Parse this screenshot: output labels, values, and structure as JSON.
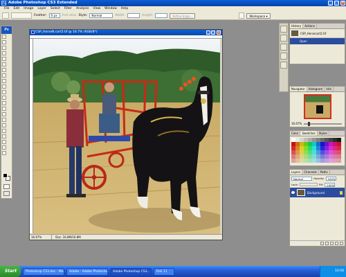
{
  "app": {
    "title": "Adobe Photoshop CS3 Extended"
  },
  "menu": [
    "File",
    "Edit",
    "Image",
    "Layer",
    "Select",
    "Filter",
    "Analysis",
    "View",
    "Window",
    "Help"
  ],
  "options": {
    "feather_label": "Feather:",
    "feather_value": "0 px",
    "antialias_label": "Anti-alias",
    "style_label": "Style:",
    "style_value": "Normal",
    "width_label": "Width:",
    "height_label": "Height:",
    "refine_edge": "Refine Edge...",
    "workspace": "Workspace ▾"
  },
  "tools": {
    "badge": "Ps"
  },
  "document": {
    "title": "CSP_HorseN.cart2.tif @ 16.7% (RGB/8*)",
    "zoom": "16.67%",
    "doc_info": "Doc: 16.8M/16.8M"
  },
  "panels": {
    "history": {
      "tabs": [
        "History",
        "Actions"
      ],
      "snapshot": "CSP_Horsecart2.tif",
      "open": "Open"
    },
    "navigator": {
      "tabs": [
        "Navigator",
        "Histogram",
        "Info"
      ],
      "zoom": "16.67%"
    },
    "swatches": {
      "tabs": [
        "Color",
        "Swatches",
        "Styles"
      ]
    },
    "layers": {
      "tabs": [
        "Layers",
        "Channels",
        "Paths"
      ],
      "blend": "Normal",
      "opacity_label": "Opacity:",
      "opacity": "100%",
      "lock_label": "Lock:",
      "fill_label": "Fill:",
      "fill": "100%",
      "layer_name": "Background"
    }
  },
  "taskbar": {
    "start": "Start",
    "items": [
      "Photoshop CS3.doc - Mic...",
      "Adobe - Adobe Photoshop...",
      "Adobe Photoshop CS3...",
      "Dsk 11"
    ],
    "clock": "10:58"
  },
  "colors": {
    "xp_blue": "#0a47a6",
    "workspace": "#8e8e8e",
    "selected_layer": "#2b4d9e"
  }
}
